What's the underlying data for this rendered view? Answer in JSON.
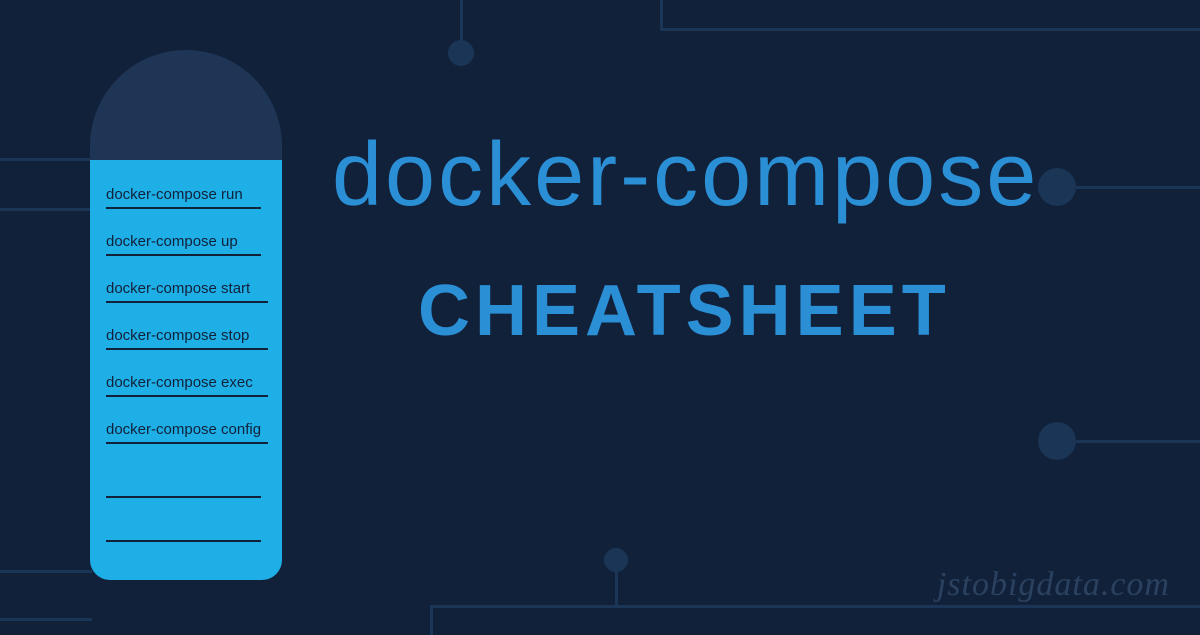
{
  "title": {
    "main": "docker-compose",
    "sub": "CHEATSHEET"
  },
  "commands": [
    "docker-compose run",
    "docker-compose up",
    "docker-compose start",
    "docker-compose stop",
    "docker-compose exec",
    "docker-compose config"
  ],
  "watermark": "jstobigdata.com",
  "colors": {
    "background": "#12213a",
    "accent": "#2b8fd6",
    "card": "#1eafe7",
    "circuit": "#1a3556"
  }
}
